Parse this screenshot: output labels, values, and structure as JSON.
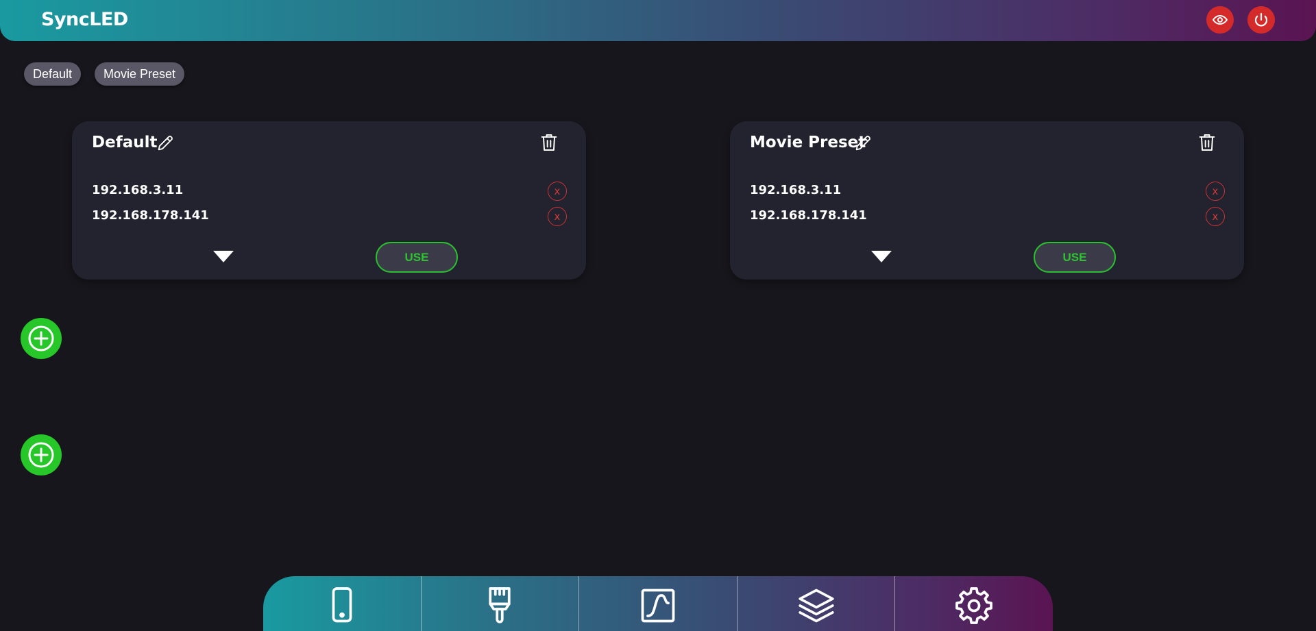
{
  "header": {
    "title": "SyncLED",
    "buttons": [
      {
        "name": "visibility",
        "icon": "eye-icon"
      },
      {
        "name": "power",
        "icon": "power-icon"
      }
    ]
  },
  "chips": [
    {
      "label": "Default"
    },
    {
      "label": "Movie Preset"
    }
  ],
  "presets": [
    {
      "title": "Default",
      "ips": [
        "192.168.3.11",
        "192.168.178.141"
      ],
      "remove_label": "x",
      "use_label": "USE"
    },
    {
      "title": "Movie Preset",
      "ips": [
        "192.168.3.11",
        "192.168.178.141"
      ],
      "remove_label": "x",
      "use_label": "USE"
    }
  ],
  "add_buttons": [
    {
      "icon": "plus-circle-icon"
    },
    {
      "icon": "plus-circle-icon"
    }
  ],
  "bottom_nav": [
    {
      "icon": "device-icon"
    },
    {
      "icon": "brush-icon"
    },
    {
      "icon": "curve-chart-icon"
    },
    {
      "icon": "layers-icon"
    },
    {
      "icon": "gear-icon"
    }
  ],
  "colors": {
    "accent_green": "#27c72a",
    "danger_red": "#d42a2a",
    "background": "#17161c",
    "card": "#23222f"
  }
}
